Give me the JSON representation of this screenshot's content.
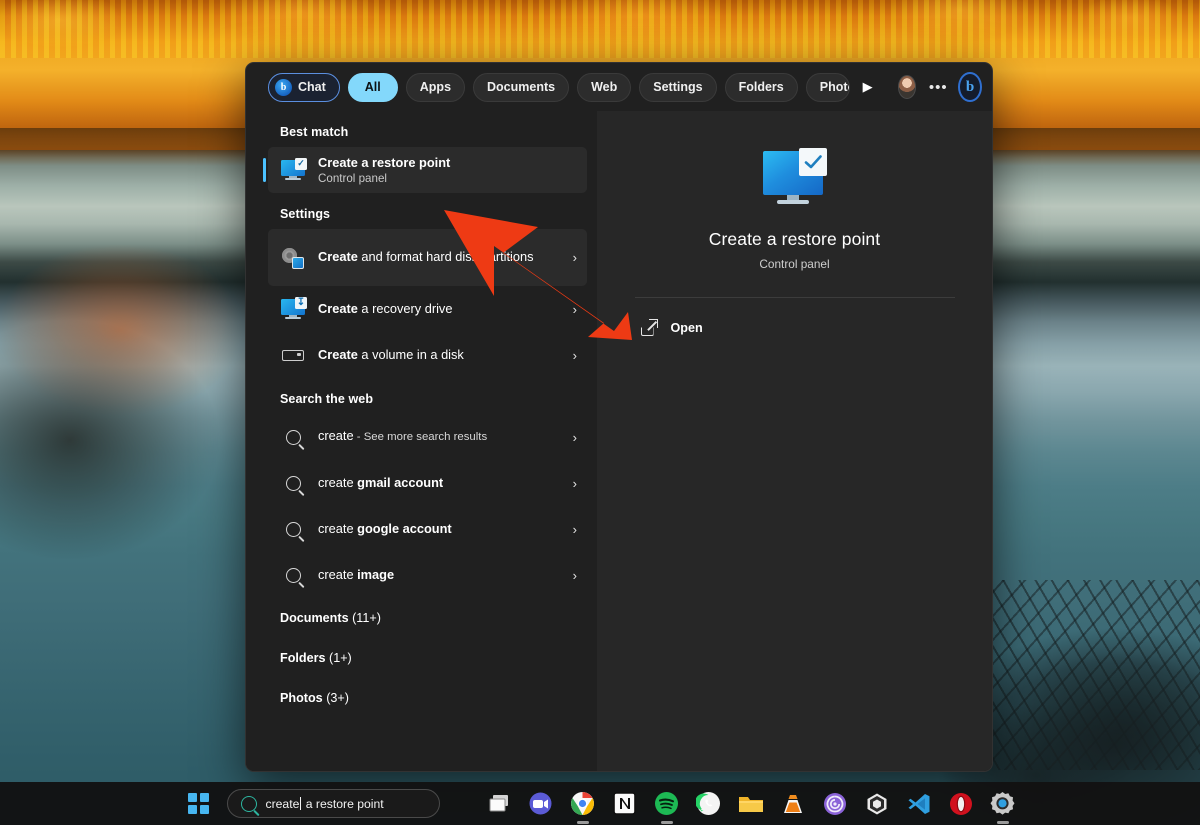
{
  "tabs": [
    {
      "id": "chat",
      "label": "Chat",
      "icon": "bing-chat-icon",
      "state": "outlined"
    },
    {
      "id": "all",
      "label": "All",
      "icon": "",
      "state": "active"
    },
    {
      "id": "apps",
      "label": "Apps",
      "icon": "",
      "state": "normal"
    },
    {
      "id": "documents",
      "label": "Documents",
      "icon": "",
      "state": "normal"
    },
    {
      "id": "web",
      "label": "Web",
      "icon": "",
      "state": "normal"
    },
    {
      "id": "settings",
      "label": "Settings",
      "icon": "",
      "state": "normal"
    },
    {
      "id": "folders",
      "label": "Folders",
      "icon": "",
      "state": "normal"
    },
    {
      "id": "photos",
      "label": "Photos",
      "icon": "",
      "state": "clipped"
    }
  ],
  "tabbar": {
    "bing_glyph": "b",
    "play_glyph": "▶",
    "more_glyph": "•••",
    "bing_logo_glyph": "b"
  },
  "sections": {
    "best_match_heading": "Best match",
    "settings_heading": "Settings",
    "web_heading": "Search the web"
  },
  "best_match": {
    "title": "Create a restore point",
    "subtitle": "Control panel",
    "icon": "restore-point-monitor-icon"
  },
  "settings_results": [
    {
      "title_bold": "Create",
      "title_rest": " and format hard disk partitions",
      "icon": "disk-partitions-gear-icon",
      "chevron": "›",
      "hovered": true
    },
    {
      "title_bold": "Create",
      "title_rest": " a recovery drive",
      "icon": "recovery-drive-monitor-icon",
      "chevron": "›",
      "hovered": false
    },
    {
      "title_bold": "Create",
      "title_rest": " a volume in a disk",
      "icon": "volume-disk-icon",
      "chevron": "›",
      "hovered": false
    }
  ],
  "web_results": [
    {
      "query": "create",
      "suffix": " - See more search results",
      "bold_part": "",
      "icon": "search-icon",
      "chevron": "›"
    },
    {
      "query": "create ",
      "suffix": "",
      "bold_part": "gmail account",
      "icon": "search-icon",
      "chevron": "›"
    },
    {
      "query": "create ",
      "suffix": "",
      "bold_part": "google account",
      "icon": "search-icon",
      "chevron": "›"
    },
    {
      "query": "create ",
      "suffix": "",
      "bold_part": "image",
      "icon": "search-icon",
      "chevron": "›"
    }
  ],
  "categories": [
    {
      "label": "Documents ",
      "count": "(11+)"
    },
    {
      "label": "Folders ",
      "count": "(1+)"
    },
    {
      "label": "Photos ",
      "count": "(3+)"
    }
  ],
  "preview": {
    "title": "Create a restore point",
    "subtitle": "Control panel",
    "icon": "restore-point-monitor-icon",
    "open_label": "Open",
    "open_icon": "open-external-icon"
  },
  "taskbar": {
    "start_label": "Start",
    "search_value": "create a restore point",
    "search_value_before_caret": "create",
    "search_value_after_caret": " a restore point",
    "search_icon": "search-icon",
    "icons": [
      {
        "name": "task-view-icon",
        "label": "Task View"
      },
      {
        "name": "zoom-icon",
        "label": "Zoom"
      },
      {
        "name": "chrome-icon",
        "label": "Google Chrome"
      },
      {
        "name": "notion-icon",
        "label": "Notion"
      },
      {
        "name": "spotify-icon",
        "label": "Spotify"
      },
      {
        "name": "whatsapp-icon",
        "label": "WhatsApp"
      },
      {
        "name": "file-explorer-icon",
        "label": "File Explorer"
      },
      {
        "name": "vlc-icon",
        "label": "VLC media player"
      },
      {
        "name": "bittorrent-icon",
        "label": "BitTorrent"
      },
      {
        "name": "package-icon",
        "label": "Package"
      },
      {
        "name": "vscode-icon",
        "label": "Visual Studio Code"
      },
      {
        "name": "opera-icon",
        "label": "Opera"
      },
      {
        "name": "settings-gear-icon",
        "label": "Settings"
      }
    ]
  },
  "colors": {
    "accent_blue": "#4cc2ff",
    "active_tab": "#83d8fb",
    "panel_left": "#202020",
    "panel_right": "#272727",
    "arrow_red": "#ee3a14"
  }
}
